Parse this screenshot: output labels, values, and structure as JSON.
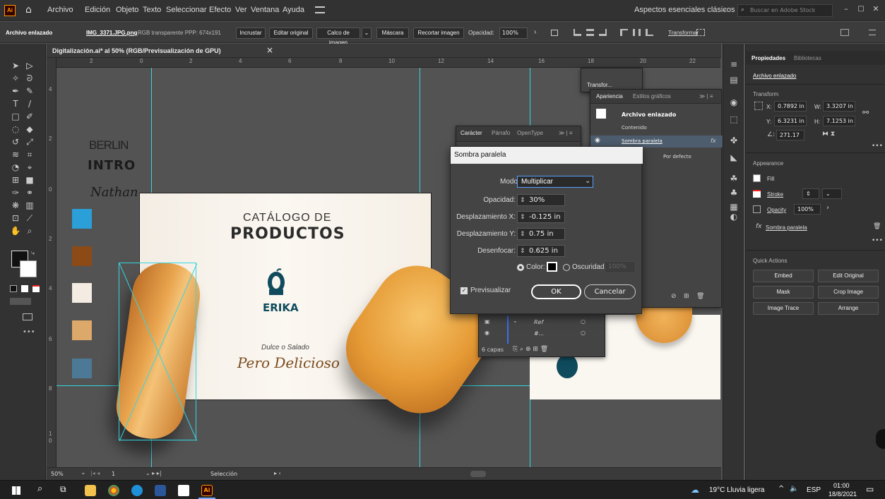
{
  "menubar": {
    "app_icon": "Ai",
    "items": [
      "Archivo",
      "Edición",
      "Objeto",
      "Texto",
      "Seleccionar",
      "Efecto",
      "Ver",
      "Ventana",
      "Ayuda"
    ],
    "workspace": "Aspectos esenciales clásicos",
    "search_placeholder": "Buscar en Adobe Stock"
  },
  "control_bar": {
    "object_type": "Archivo enlazado",
    "file_name": "IMG_3371.JPG.png",
    "file_info": "RGB transparente  PPP: 674x191",
    "embed": "Incrustar",
    "edit_original": "Editar original",
    "image_trace": "Calco de imagen",
    "mask": "Máscara",
    "crop": "Recortar imagen",
    "opacity_label": "Opacidad:",
    "opacity_value": "100%",
    "transform": "Transformar"
  },
  "document": {
    "tab_title": "Digitalización.ai* al 50% (RGB/Previsualización de GPU)",
    "close": "×"
  },
  "ruler_h_labels": [
    "2",
    "0",
    "2",
    "4",
    "6",
    "8",
    "10",
    "12",
    "14",
    "16",
    "18",
    "20",
    "22"
  ],
  "ruler_v_labels": [
    "4",
    "2",
    "0",
    "2",
    "4",
    "6",
    "8",
    "1",
    "0"
  ],
  "artwork": {
    "side_text_1": "BERLIN",
    "side_text_2": "INTRO",
    "side_text_3": "Nathan",
    "swatch_colors": [
      "#2a9fd8",
      "#8b4a16",
      "#f4ece2",
      "#dca96a",
      "#4c7a96"
    ],
    "catalog_line1": "CATÁLOGO DE",
    "catalog_line2": "PRODUCTOS",
    "brand": "ERIKA",
    "tagline1": "Dulce o Salado",
    "tagline2": "Pero Delicioso",
    "brand_color": "#0f4b5c",
    "tagline_color": "#7a4a1c"
  },
  "status_bar": {
    "zoom": "50%",
    "page": "1",
    "tool": "Selección"
  },
  "transform_mini_panel": {
    "title": "Transfor..."
  },
  "character_panel": {
    "tabs": [
      "Carácter",
      "Párrafo",
      "OpenType"
    ]
  },
  "appearance_panel": {
    "tabs": [
      "Apariencia",
      "Estilos gráficos"
    ],
    "object": "Archivo enlazado",
    "content": "Contenido",
    "effect": "Sombra paralela",
    "fx": "fx",
    "opacity_row": "Por defecto"
  },
  "layers_panel": {
    "rows": [
      "Ref",
      "#..."
    ],
    "count": "6 capas"
  },
  "drop_shadow_dialog": {
    "title": "Sombra paralela",
    "mode_label": "Modo:",
    "mode_value": "Multiplicar",
    "opacity_label": "Opacidad:",
    "opacity_value": "30%",
    "offset_x_label": "Desplazamiento X:",
    "offset_x_value": "-0.125 in",
    "offset_y_label": "Desplazamiento Y:",
    "offset_y_value": "0.75 in",
    "blur_label": "Desenfocar:",
    "blur_value": "0.625 in",
    "color_label": "Color:",
    "darkness_label": "Oscuridad:",
    "darkness_value": "100%",
    "preview_label": "Previsualizar",
    "ok": "OK",
    "cancel": "Cancelar"
  },
  "properties_panel": {
    "tabs": [
      "Propiedades",
      "Bibliotecas"
    ],
    "object": "Archivo enlazado",
    "transform_title": "Transform",
    "x_label": "X:",
    "x_value": "0.7892 in",
    "y_label": "Y:",
    "y_value": "6.3231 in",
    "w_label": "W:",
    "w_value": "3.3207 in",
    "h_label": "H:",
    "h_value": "7.1253 in",
    "angle_value": "271.17",
    "appearance_title": "Appearance",
    "fill": "Fill",
    "stroke": "Stroke",
    "opacity": "Opacity",
    "opacity_value": "100%",
    "effect": "Sombra paralela",
    "quick_actions_title": "Quick Actions",
    "qa_buttons": [
      "Embed",
      "Edit Original",
      "Mask",
      "Crop Image",
      "Image Trace",
      "Arrange"
    ]
  },
  "taskbar": {
    "weather": "19°C  Lluvia ligera",
    "lang": "ESP",
    "time": "01:00",
    "date": "18/8/2021"
  }
}
